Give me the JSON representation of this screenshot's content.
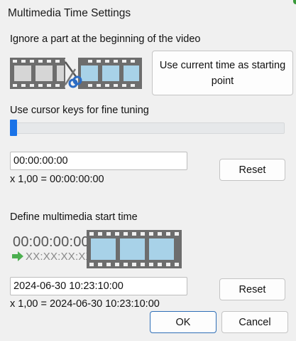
{
  "window": {
    "title": "Multimedia Time Settings"
  },
  "section1": {
    "heading": "Ignore a part at the beginning of the video",
    "use_current_button": "Use current time as starting point",
    "fine_tuning_label": "Use cursor keys for fine tuning",
    "slider_value": 0,
    "offset_value": "00:00:00:00",
    "multiplier_line": "x 1,00 = 00:00:00:00",
    "reset_label": "Reset"
  },
  "section2": {
    "heading": "Define multimedia start time",
    "timecode_top": "00:00:00:00",
    "timecode_bottom": "XX:XX:XX:XX",
    "start_value": "2024-06-30 10:23:10:00",
    "multiplier_line": "x 1,00 = 2024-06-30 10:23:10:00",
    "reset_label": "Reset"
  },
  "footer": {
    "ok_label": "OK",
    "cancel_label": "Cancel"
  },
  "colors": {
    "accent": "#1a73e8",
    "film_frame": "#a8d2e8",
    "arrow": "#4caf50"
  },
  "icons": [
    "filmstrip-scissors-icon",
    "filmstrip-icon",
    "green-arrow-icon"
  ]
}
